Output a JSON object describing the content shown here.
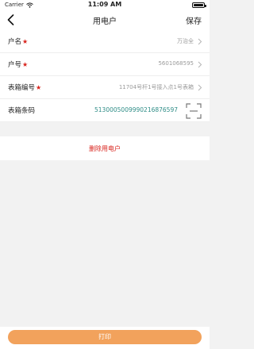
{
  "status_bar": {
    "carrier": "Carrier",
    "time": "11:09 AM"
  },
  "nav": {
    "title": "用电户",
    "save_label": "保存"
  },
  "form": {
    "rows": [
      {
        "label": "户名",
        "required": "★",
        "value": "万治全"
      },
      {
        "label": "户号",
        "required": "★",
        "value": "5601068595"
      },
      {
        "label": "表箱编号",
        "required": "★",
        "value": "11704号杆1号接入点1号表箱"
      },
      {
        "label": "表箱条码",
        "value": "5130005009990216876597"
      }
    ]
  },
  "actions": {
    "delete_label": "删除用电户",
    "print_label": "打印"
  },
  "colors": {
    "accent": "#f2a25c",
    "danger": "#d8221b",
    "barcode": "#2f8d87"
  },
  "icons": [
    "back-chevron-icon",
    "chevron-right-icon",
    "scan-icon",
    "wifi-icon",
    "battery-icon"
  ]
}
